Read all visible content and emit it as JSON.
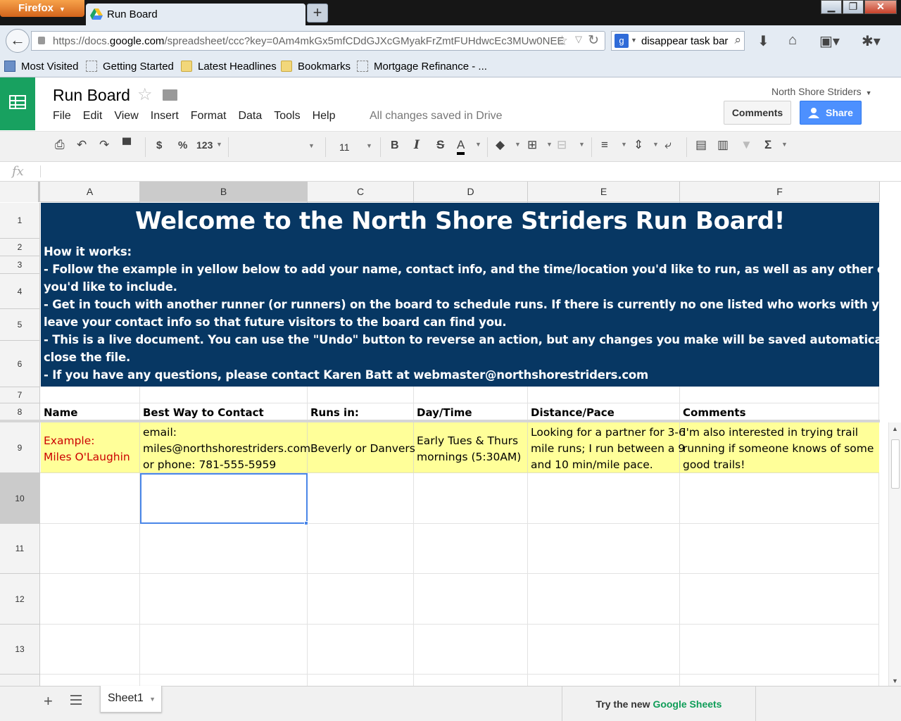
{
  "browser": {
    "menu_label": "Firefox",
    "tab_title": "Run Board",
    "url_prefix": "https://docs.",
    "url_domain": "google.com",
    "url_rest": "/spreadsheet/ccc?key=0Am4mkGx5mfCDdGJXcGMyakFrZmtFUHdwcEc3MUw0NEE",
    "search_text": "disappear task bar",
    "bookmarks": [
      "Most Visited",
      "Getting Started",
      "Latest Headlines",
      "Bookmarks",
      "Mortgage Refinance - ..."
    ]
  },
  "app": {
    "doc_title": "Run Board",
    "menus": [
      "File",
      "Edit",
      "View",
      "Insert",
      "Format",
      "Data",
      "Tools",
      "Help"
    ],
    "save_status": "All changes saved in Drive",
    "account": "North Shore Striders",
    "comments_label": "Comments",
    "share_label": "Share",
    "brand_color": "#18a160",
    "share_color": "#4d90fe"
  },
  "toolbar": {
    "currency": "$",
    "percent": "%",
    "number_format": "123",
    "font_family": "",
    "font_size": "11",
    "bold": "B",
    "italic": "I",
    "strike": "S",
    "text_color": "A",
    "sum": "Σ"
  },
  "formula_bar": {
    "icon": "fx",
    "value": ""
  },
  "grid": {
    "columns": [
      "A",
      "B",
      "C",
      "D",
      "E",
      "F"
    ],
    "rows": [
      "1",
      "2",
      "3",
      "4",
      "5",
      "6",
      "7",
      "8",
      "9",
      "10",
      "11",
      "12",
      "13"
    ],
    "selected_cell": "B10",
    "banner_color": "#073763",
    "example_color": "#ffff99",
    "banner_title": "Welcome to the North Shore Striders Run Board!",
    "banner_lines": [
      "How it works:",
      "- Follow the example in yellow below to add your name, contact info, and the time/location you'd like to run, as well as any other comments",
      "you'd like to include.",
      "- Get in touch with another runner (or runners) on the board to schedule runs. If there is currently no one listed who works with your schedule,",
      "leave your contact info so that future visitors to the board can find you.",
      "- This is a live document. You can use the \"Undo\" button to reverse an action, but any changes you make will be saved automatically when you",
      "close the file.",
      "- If you have any questions, please contact Karen Batt at webmaster@northshorestriders.com"
    ],
    "headers": [
      "Name",
      "Best Way to Contact",
      "Runs in:",
      "Day/Time",
      "Distance/Pace",
      "Comments"
    ],
    "example": {
      "name": [
        "Example:",
        "Miles O'Laughin"
      ],
      "contact": [
        "email:",
        "miles@northshorestriders.com",
        "or phone: 781-555-5959"
      ],
      "runs_in": [
        "Beverly or Danvers"
      ],
      "day_time": [
        "Early Tues & Thurs",
        "mornings (5:30AM)"
      ],
      "distance": [
        "Looking for a partner for 3-6",
        "mile runs; I run between a 9",
        "and 10 min/mile pace."
      ],
      "comments": [
        "I'm also interested in trying trail",
        "running if someone knows of some",
        "good trails!"
      ]
    }
  },
  "bottom": {
    "sheet_name": "Sheet1",
    "try_prefix": "Try the new",
    "try_product": "Google Sheets"
  }
}
